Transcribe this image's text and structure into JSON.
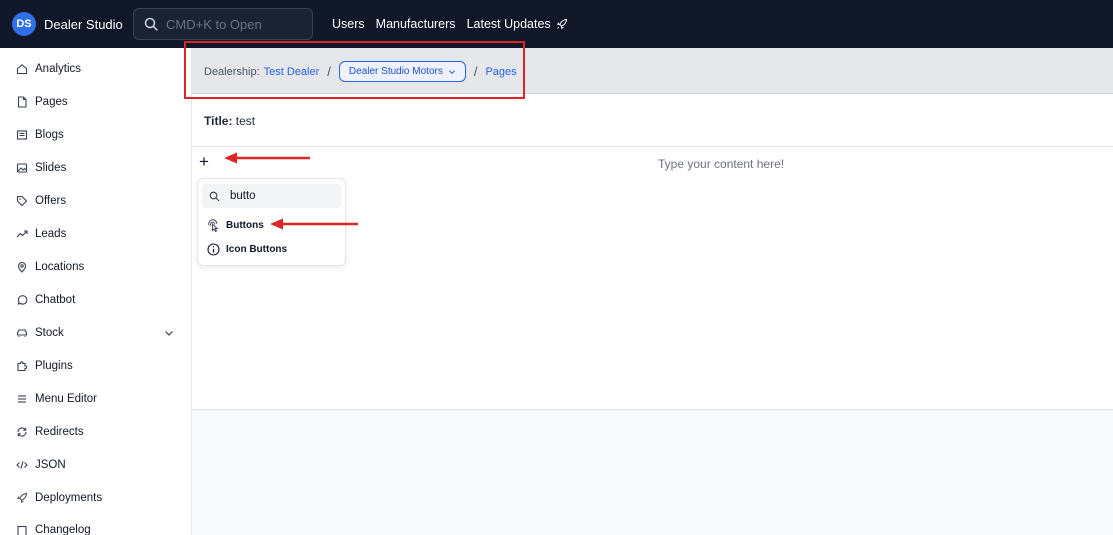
{
  "brand": {
    "logo_text": "DS",
    "name": "Dealer Studio"
  },
  "search": {
    "placeholder": "CMD+K to Open"
  },
  "topnav": {
    "users": "Users",
    "manufacturers": "Manufacturers",
    "latest_updates": "Latest Updates"
  },
  "sidebar": {
    "items": [
      {
        "label": "Analytics",
        "icon": "home-icon"
      },
      {
        "label": "Pages",
        "icon": "file-icon"
      },
      {
        "label": "Blogs",
        "icon": "newspaper-icon"
      },
      {
        "label": "Slides",
        "icon": "image-icon"
      },
      {
        "label": "Offers",
        "icon": "tag-icon"
      },
      {
        "label": "Leads",
        "icon": "trending-up-icon"
      },
      {
        "label": "Locations",
        "icon": "map-pin-icon"
      },
      {
        "label": "Chatbot",
        "icon": "message-circle-icon"
      },
      {
        "label": "Stock",
        "icon": "car-icon"
      },
      {
        "label": "Plugins",
        "icon": "puzzle-icon"
      },
      {
        "label": "Menu Editor",
        "icon": "menu-icon"
      },
      {
        "label": "Redirects",
        "icon": "refresh-icon"
      },
      {
        "label": "JSON",
        "icon": "code-icon"
      },
      {
        "label": "Deployments",
        "icon": "rocket-icon"
      },
      {
        "label": "Changelog",
        "icon": "list-icon"
      }
    ]
  },
  "breadcrumb": {
    "dealership_label": "Dealership:",
    "dealership_value": "Test Dealer",
    "site": "Dealer Studio Motors",
    "section": "Pages"
  },
  "page": {
    "title_label": "Title:",
    "title_value": "test"
  },
  "editor": {
    "placeholder": "Type your content here!"
  },
  "block_menu": {
    "search_value": "butto",
    "items": [
      {
        "label": "Buttons",
        "icon": "pointer-click-icon"
      },
      {
        "label": "Icon Buttons",
        "icon": "info-icon"
      }
    ]
  },
  "colors": {
    "topbar": "#0f1729",
    "accent": "#2563eb",
    "annotation": "#dc2626"
  }
}
